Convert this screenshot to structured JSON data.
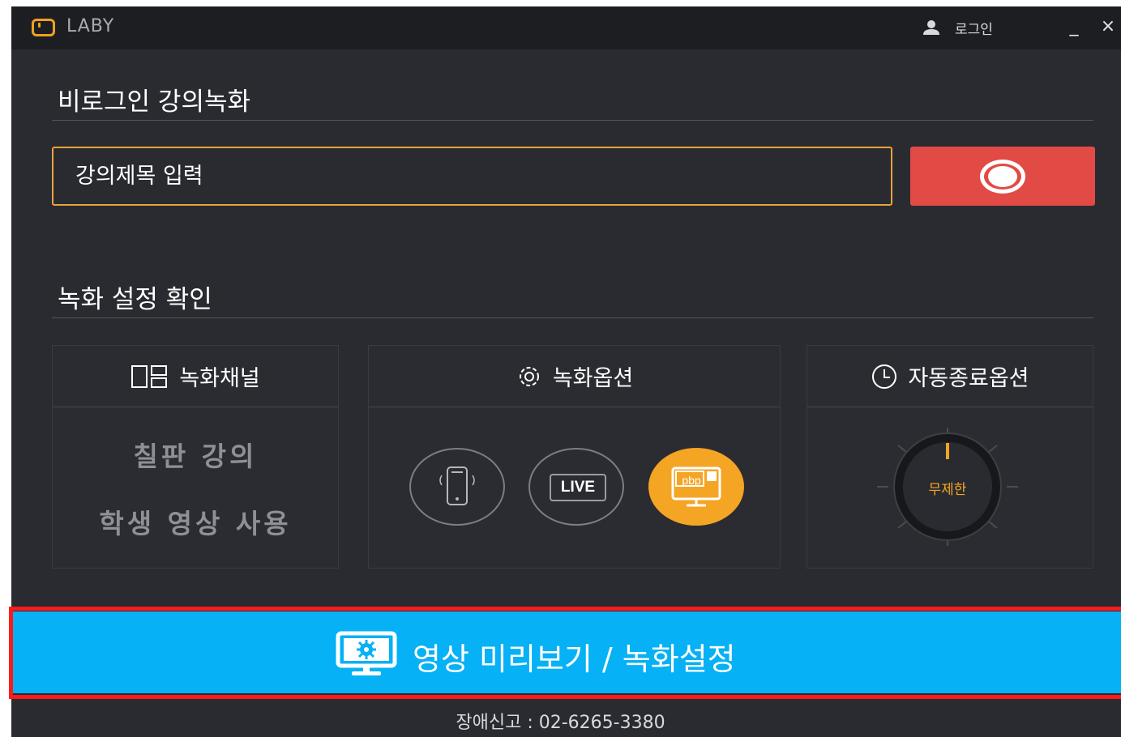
{
  "app": {
    "name": "LABY",
    "login_label": "로그인",
    "minimize_label": "_",
    "close_label": "×"
  },
  "lecture": {
    "section_title": "비로그인 강의녹화",
    "title_placeholder": "강의제목 입력"
  },
  "settings": {
    "section_title": "녹화 설정 확인",
    "channel": {
      "label": "녹화채널",
      "icon": "layout-icon",
      "lines": [
        "칠판 강의",
        "학생 영상 사용"
      ]
    },
    "options": {
      "label": "녹화옵션",
      "icon": "gear-icon",
      "items": [
        {
          "name": "mobile",
          "icon": "phone-icon",
          "selected": false
        },
        {
          "name": "live",
          "label": "LIVE",
          "selected": false
        },
        {
          "name": "pbp",
          "label": "pbp",
          "icon": "monitor-icon",
          "selected": true
        }
      ]
    },
    "auto_stop": {
      "label": "자동종료옵션",
      "icon": "clock-icon",
      "value_label": "무제한"
    }
  },
  "preview_button": {
    "label": "영상 미리보기 / 녹화설정",
    "icon": "monitor-gear-icon"
  },
  "footer": {
    "support_text": "장애신고 : 02-6265-3380"
  },
  "colors": {
    "background": "#2a2b30",
    "titlebar": "#1d1e22",
    "accent_orange": "#f0a020",
    "record_red": "#e24b45",
    "preview_blue": "#06b1f5",
    "highlight_red": "#ff1a1a"
  }
}
